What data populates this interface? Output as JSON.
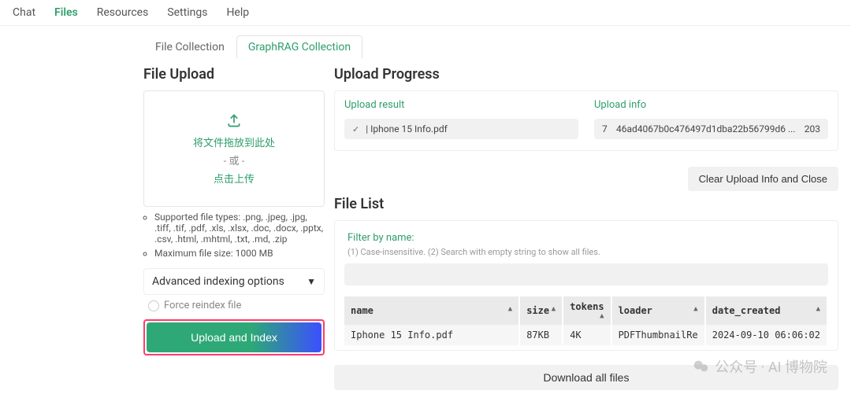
{
  "nav": {
    "items": [
      "Chat",
      "Files",
      "Resources",
      "Settings",
      "Help"
    ],
    "active": "Files"
  },
  "tabs": {
    "items": [
      "File Collection",
      "GraphRAG Collection"
    ],
    "active": "GraphRAG Collection"
  },
  "left": {
    "title": "File Upload",
    "drop_line1": "将文件拖放到此处",
    "drop_or": "- 或 -",
    "drop_line2": "点击上传",
    "hint_types": "Supported file types: .png, .jpeg, .jpg, .tiff, .tif, .pdf, .xls, .xlsx, .doc, .docx, .pptx, .csv, .html, .mhtml, .txt, .md, .zip",
    "hint_size": "Maximum file size: 1000 MB",
    "adv_label": "Advanced indexing options",
    "force_label": "Force reindex file",
    "upload_btn": "Upload and Index"
  },
  "progress": {
    "title": "Upload Progress",
    "result_label": "Upload result",
    "result_file": "| Iphone 15 Info.pdf",
    "info_label": "Upload info",
    "info_n1": "7",
    "info_hash": "46ad4067b0c476497d1dba22b56799d6 ...",
    "info_n2": "203",
    "clear_btn": "Clear Upload Info and Close"
  },
  "filelist": {
    "title": "File List",
    "filter_label": "Filter by name:",
    "filter_hint": "(1) Case-insensitive. (2) Search with empty string to show all files.",
    "filter_value": "",
    "headers": {
      "name": "name",
      "size": "size",
      "tokens": "tokens",
      "loader": "loader",
      "date": "date_created"
    },
    "rows": [
      {
        "name": "Iphone 15 Info.pdf",
        "size": "87KB",
        "tokens": "4K",
        "loader": "PDFThumbnailRe",
        "date": "2024-09-10 06:06:02"
      }
    ],
    "download_btn": "Download all files"
  },
  "watermark": "公众号 · AI 博物院"
}
